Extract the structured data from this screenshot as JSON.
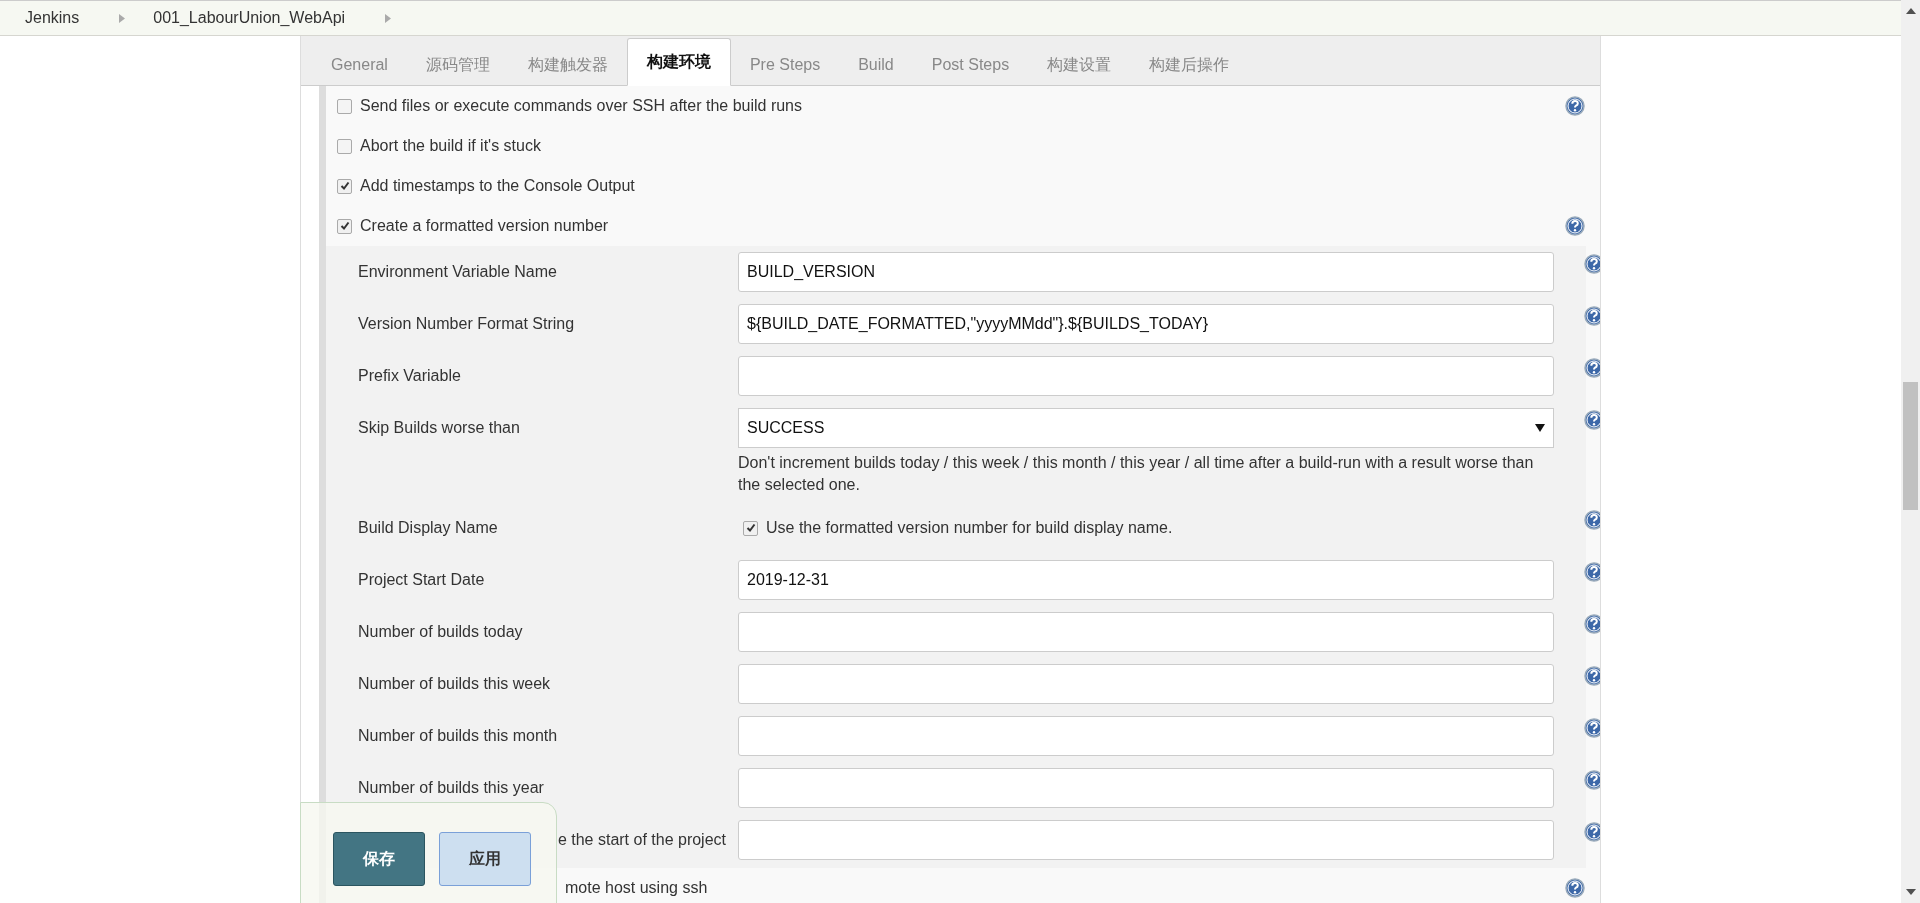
{
  "breadcrumbs": [
    {
      "label": "Jenkins"
    },
    {
      "label": "001_LabourUnion_WebApi"
    }
  ],
  "tabs": [
    {
      "label": "General",
      "selected": false
    },
    {
      "label": "源码管理",
      "selected": false
    },
    {
      "label": "构建触发器",
      "selected": false
    },
    {
      "label": "构建环境",
      "selected": true
    },
    {
      "label": "Pre Steps",
      "selected": false
    },
    {
      "label": "Build",
      "selected": false
    },
    {
      "label": "Post Steps",
      "selected": false
    },
    {
      "label": "构建设置",
      "selected": false
    },
    {
      "label": "构建后操作",
      "selected": false
    }
  ],
  "options": [
    {
      "label": "Send files or execute commands over SSH after the build runs",
      "checked": false,
      "help": true
    },
    {
      "label": "Abort the build if it's stuck",
      "checked": false,
      "help": false
    },
    {
      "label": "Add timestamps to the Console Output",
      "checked": true,
      "help": false
    },
    {
      "label": "Create a formatted version number",
      "checked": true,
      "help": true
    }
  ],
  "version_fields": [
    {
      "kind": "text",
      "label": "Environment Variable Name",
      "value": "BUILD_VERSION"
    },
    {
      "kind": "text",
      "label": "Version Number Format String",
      "value": "${BUILD_DATE_FORMATTED,\"yyyyMMdd\"}.${BUILDS_TODAY}"
    },
    {
      "kind": "text",
      "label": "Prefix Variable"
    },
    {
      "kind": "select",
      "label": "Skip Builds worse than",
      "value": "SUCCESS",
      "note": "Don't increment builds today / this week / this month / this year / all time after a build-run with a result worse than the selected one."
    },
    {
      "kind": "checkbox",
      "label": "Build Display Name",
      "checked": true,
      "text": "Use the formatted version number for build display name."
    },
    {
      "kind": "text",
      "label": "Project Start Date",
      "value": "2019-12-31"
    },
    {
      "kind": "text",
      "label": "Number of builds today"
    },
    {
      "kind": "text",
      "label": "Number of builds this week"
    },
    {
      "kind": "text",
      "label": "Number of builds this month"
    },
    {
      "kind": "text",
      "label": "Number of builds this year"
    },
    {
      "kind": "hidden-label",
      "label": "e the start of the project"
    }
  ],
  "more_options": [
    {
      "label": "mote host using ssh",
      "help": true
    }
  ],
  "save_bar": {
    "save": "保存",
    "apply": "应用"
  }
}
